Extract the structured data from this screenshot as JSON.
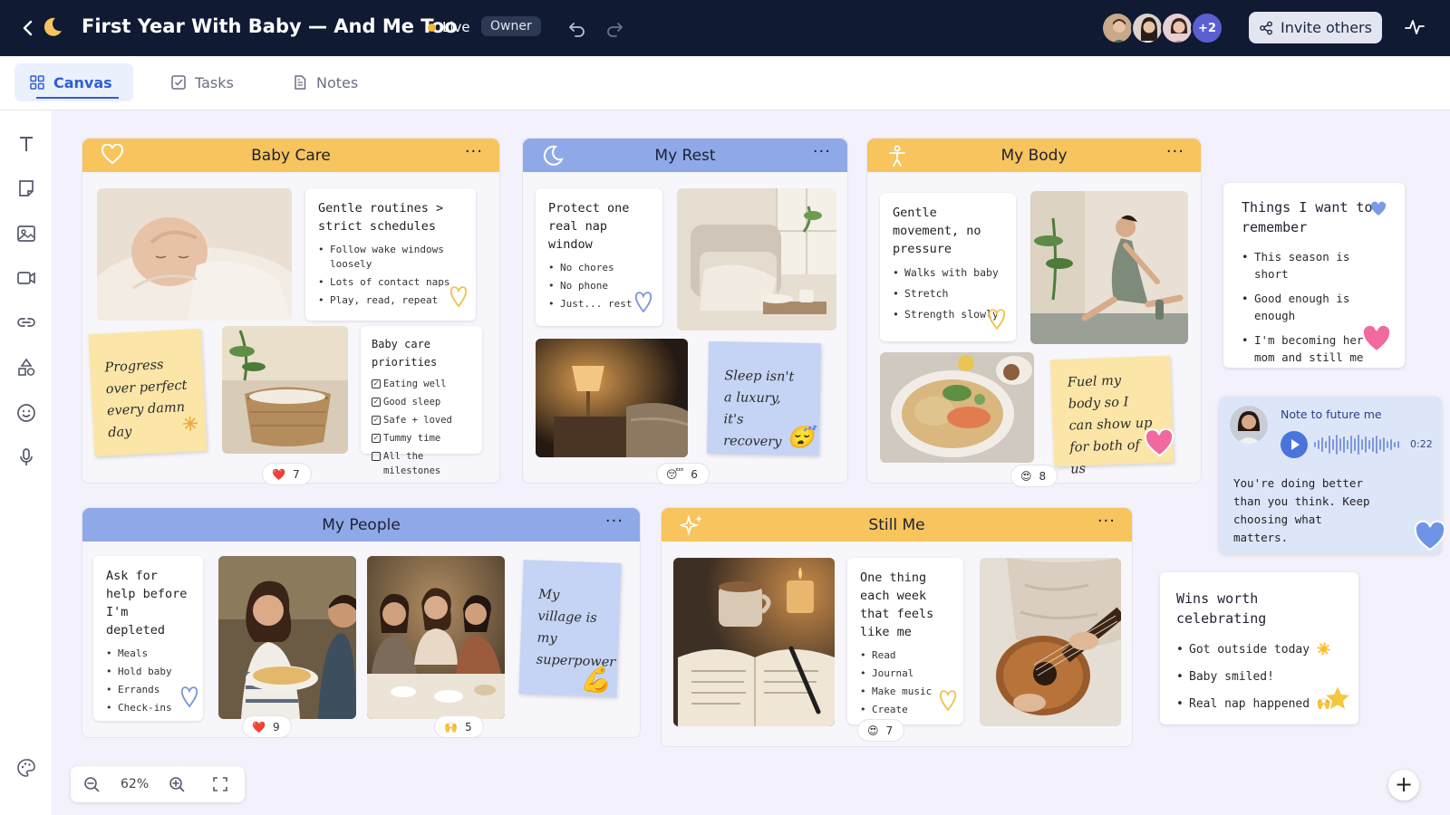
{
  "header": {
    "title": "First Year With Baby — And Me Too",
    "live_label": "Live",
    "owner_label": "Owner",
    "collaborators_more": "+2",
    "invite_label": "Invite others"
  },
  "tabs": [
    {
      "label": "Canvas",
      "active": true
    },
    {
      "label": "Tasks",
      "active": false
    },
    {
      "label": "Notes",
      "active": false
    }
  ],
  "panels": {
    "baby_care": {
      "title": "Baby Care",
      "card": {
        "title": "Gentle routines > strict schedules",
        "items": [
          "Follow wake windows loosely",
          "Lots of contact naps",
          "Play, read, repeat"
        ]
      },
      "sticky": "Progress over perfect every damn day",
      "priorities": {
        "title": "Baby care priorities",
        "items": [
          {
            "label": "Eating well",
            "checked": true
          },
          {
            "label": "Good sleep",
            "checked": true
          },
          {
            "label": "Safe + loved",
            "checked": true
          },
          {
            "label": "Tummy time",
            "checked": true
          },
          {
            "label": "All the milestones",
            "checked": false
          }
        ]
      },
      "reaction": {
        "emoji": "❤️",
        "count": "7"
      }
    },
    "my_rest": {
      "title": "My Rest",
      "card": {
        "title": "Protect one real nap window",
        "items": [
          "No chores",
          "No phone",
          "Just... rest"
        ]
      },
      "sticky": "Sleep isn't a luxury, it's recovery",
      "reaction": {
        "emoji": "😴",
        "count": "6"
      }
    },
    "my_body": {
      "title": "My Body",
      "card": {
        "title": "Gentle movement, no pressure",
        "items": [
          "Walks with baby",
          "Stretch",
          "Strength slowly"
        ]
      },
      "sticky": "Fuel my body so I can show up for both of us",
      "reaction": {
        "emoji": "😍",
        "count": "8"
      }
    },
    "my_people": {
      "title": "My People",
      "card": {
        "title": "Ask for help before I'm depleted",
        "items": [
          "Meals",
          "Hold baby",
          "Errands",
          "Check-ins"
        ]
      },
      "sticky": "My village is my superpower",
      "reactions": [
        {
          "emoji": "❤️",
          "count": "9"
        },
        {
          "emoji": "🙌",
          "count": "5"
        }
      ]
    },
    "still_me": {
      "title": "Still Me",
      "card": {
        "title": "One thing each week that feels like me",
        "items": [
          "Read",
          "Journal",
          "Make music",
          "Create"
        ]
      },
      "reaction": {
        "emoji": "😍",
        "count": "7"
      }
    }
  },
  "remember": {
    "title": "Things I want to remember",
    "items": [
      "This season is short",
      "Good enough is enough",
      "I'm becoming her mom and still me"
    ]
  },
  "voice_note": {
    "title": "Note to future me",
    "duration": "0:22",
    "text": "You're doing better than you think. Keep choosing what matters."
  },
  "wins": {
    "title": "Wins worth celebrating",
    "items": [
      "Got outside today ☀️",
      "Baby smiled!",
      "Real nap happened 🙌"
    ]
  },
  "zoom": {
    "level": "62%"
  },
  "colors": {
    "topbar": "#101a33",
    "accent": "#2e5ed8",
    "yellow_header": "#f7c45d",
    "blue_header": "#8fa9e8",
    "live_dot": "#f5b533"
  }
}
